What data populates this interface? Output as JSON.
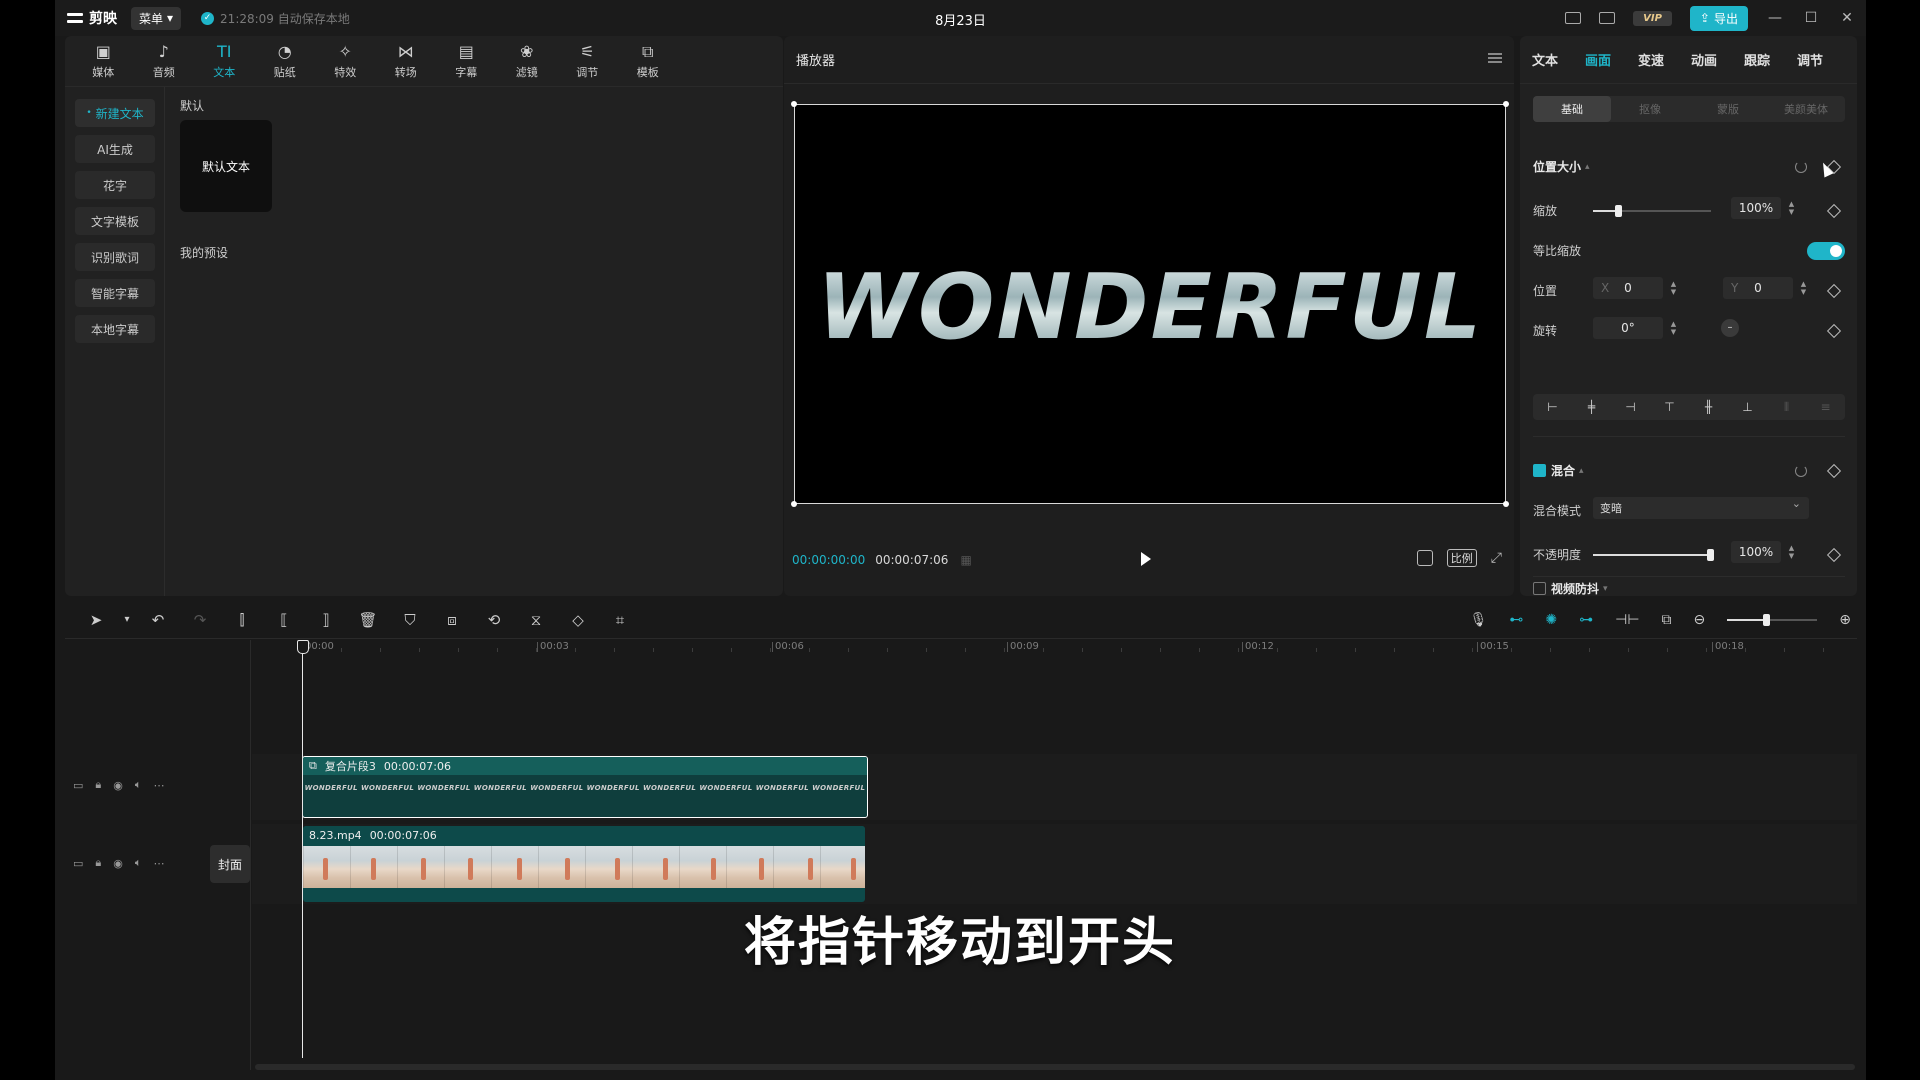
{
  "app": {
    "logo_text": "剪映",
    "menu_label": "菜单",
    "autosave_text": "21:28:09 自动保存本地",
    "window_title": "8月23日",
    "vip_label": "VIP",
    "export_label": "导出"
  },
  "tool_tabs": [
    {
      "label": "媒体",
      "icon": "media-icon",
      "glyph": "▣"
    },
    {
      "label": "音频",
      "icon": "audio-icon",
      "glyph": "♪"
    },
    {
      "label": "文本",
      "icon": "text-icon",
      "glyph": "TI"
    },
    {
      "label": "贴纸",
      "icon": "sticker-icon",
      "glyph": "◔"
    },
    {
      "label": "特效",
      "icon": "effects-icon",
      "glyph": "✧"
    },
    {
      "label": "转场",
      "icon": "transition-icon",
      "glyph": "⋈"
    },
    {
      "label": "字幕",
      "icon": "caption-icon",
      "glyph": "▤"
    },
    {
      "label": "滤镜",
      "icon": "filter-icon",
      "glyph": "❀"
    },
    {
      "label": "调节",
      "icon": "adjust-icon",
      "glyph": "⚟"
    },
    {
      "label": "模板",
      "icon": "template-icon",
      "glyph": "⧉"
    }
  ],
  "text_sidebar": [
    "新建文本",
    "AI生成",
    "花字",
    "文字模板",
    "识别歌词",
    "智能字幕",
    "本地字幕"
  ],
  "text_panel": {
    "default_label": "默认",
    "preset_card": "默认文本",
    "my_presets": "我的预设"
  },
  "player": {
    "title": "播放器",
    "preview_text": "WONDERFUL",
    "current_time": "00:00:00:00",
    "duration": "00:00:07:06",
    "ratio_label": "比例"
  },
  "props": {
    "tabs": [
      "文本",
      "画面",
      "变速",
      "动画",
      "跟踪",
      "调节"
    ],
    "active_tab": 1,
    "subtabs": [
      "基础",
      "抠像",
      "蒙版",
      "美颜美体"
    ],
    "pos_size_title": "位置大小",
    "scale_label": "缩放",
    "scale_value": "100%",
    "scale_fraction": 0.22,
    "uniform_scale_label": "等比缩放",
    "position_label": "位置",
    "x_prefix": "X",
    "x_value": "0",
    "y_prefix": "Y",
    "y_value": "0",
    "rotate_label": "旋转",
    "rotate_value": "0°",
    "blend_title": "混合",
    "blend_mode_label": "混合模式",
    "blend_mode_value": "变暗",
    "opacity_label": "不透明度",
    "opacity_value": "100%",
    "opacity_fraction": 1.0,
    "stabilize_label": "视频防抖"
  },
  "timeline": {
    "ruler": [
      "00:00",
      "00:03",
      "00:06",
      "00:09",
      "00:12",
      "00:15",
      "00:18"
    ],
    "cover_label": "封面",
    "text_clip": {
      "name": "复合片段3",
      "duration": "00:00:07:06",
      "thumb_word": "WONDERFUL"
    },
    "video_clip": {
      "name": "8.23.mp4",
      "duration": "00:00:07:06"
    }
  },
  "subtitle": "将指针移动到开头",
  "colors": {
    "accent": "#1fb5c9",
    "panel": "#212121",
    "background": "#191919"
  }
}
